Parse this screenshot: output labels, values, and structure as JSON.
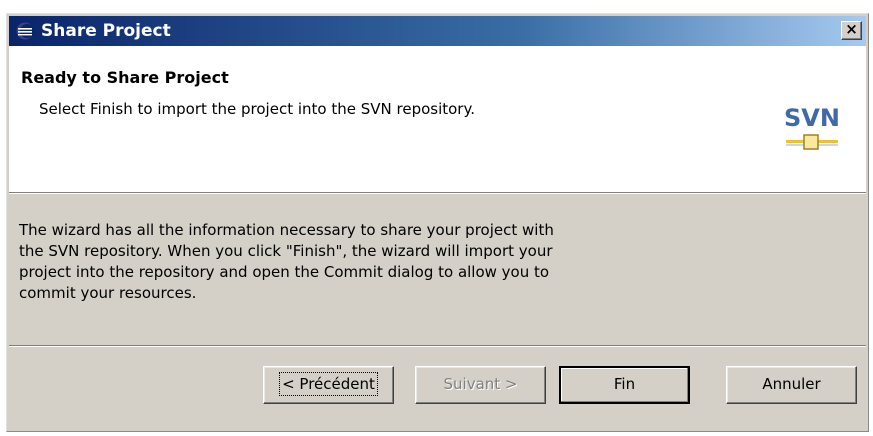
{
  "window": {
    "title": "Share Project",
    "close_label": "×"
  },
  "header": {
    "title": "Ready to Share Project",
    "description": "Select Finish to import the project into the SVN repository.",
    "logo_text": "SVN"
  },
  "body": {
    "lines": [
      "The wizard has all the information necessary to share your project with",
      "the SVN repository. When you click \"Finish\", the wizard will import your",
      "project into the repository and open the Commit dialog to allow you to",
      "commit your resources."
    ]
  },
  "buttons": {
    "back_label": "< Précédent",
    "next_label": "Suivant >",
    "finish_label": "Fin",
    "cancel_label": "Annuler"
  },
  "colors": {
    "titlebar_start": "#0a246a",
    "titlebar_end": "#a6caf0",
    "dialog_bg": "#d4d0c8",
    "logo_blue": "#3e6aa8",
    "logo_gold": "#f0c030"
  }
}
